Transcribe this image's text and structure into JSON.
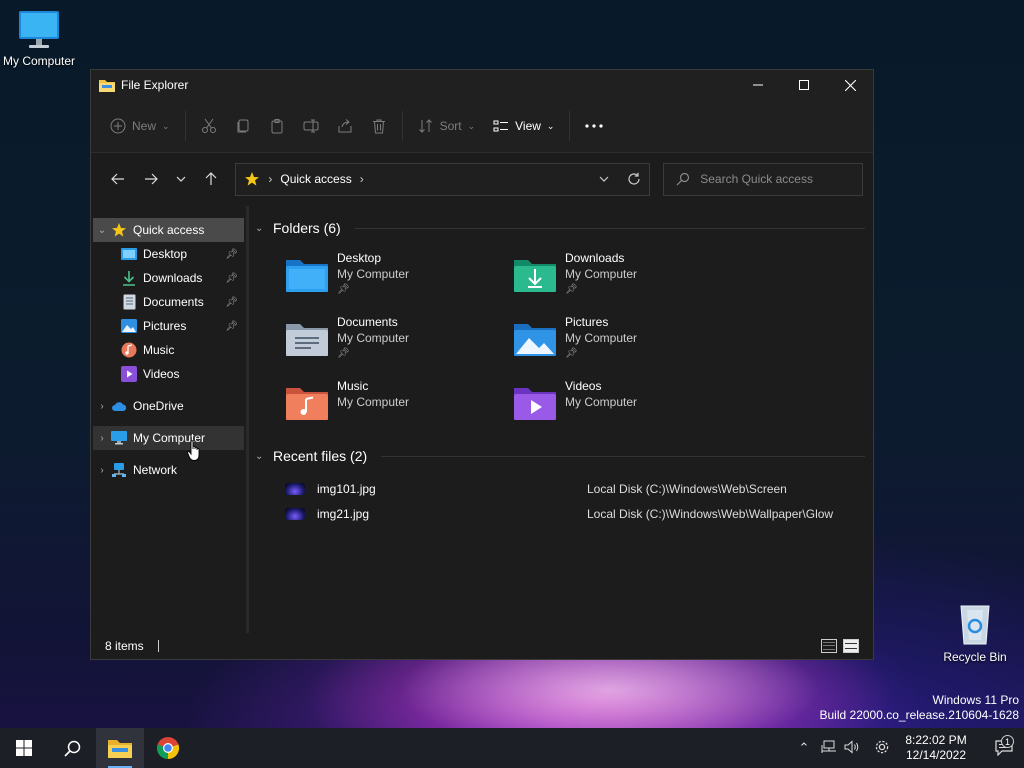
{
  "desktop": {
    "my_computer_label": "My Computer",
    "recycle_bin_label": "Recycle Bin"
  },
  "window": {
    "title": "File Explorer",
    "toolbar": {
      "new_label": "New",
      "sort_label": "Sort",
      "view_label": "View"
    },
    "address": {
      "crumb": "Quick access"
    },
    "search": {
      "placeholder": "Search Quick access"
    },
    "sidebar": {
      "items": [
        {
          "label": "Quick access"
        },
        {
          "label": "Desktop"
        },
        {
          "label": "Downloads"
        },
        {
          "label": "Documents"
        },
        {
          "label": "Pictures"
        },
        {
          "label": "Music"
        },
        {
          "label": "Videos"
        },
        {
          "label": "OneDrive"
        },
        {
          "label": "My Computer"
        },
        {
          "label": "Network"
        }
      ]
    },
    "folders_header": "Folders (6)",
    "folders": [
      {
        "name": "Desktop",
        "location": "My Computer",
        "pinned": true
      },
      {
        "name": "Downloads",
        "location": "My Computer",
        "pinned": true
      },
      {
        "name": "Documents",
        "location": "My Computer",
        "pinned": true
      },
      {
        "name": "Pictures",
        "location": "My Computer",
        "pinned": true
      },
      {
        "name": "Music",
        "location": "My Computer",
        "pinned": false
      },
      {
        "name": "Videos",
        "location": "My Computer",
        "pinned": false
      }
    ],
    "recent_header": "Recent files (2)",
    "recent": [
      {
        "name": "img101.jpg",
        "location": "Local Disk (C:)\\Windows\\Web\\Screen"
      },
      {
        "name": "img21.jpg",
        "location": "Local Disk (C:)\\Windows\\Web\\Wallpaper\\Glow"
      }
    ],
    "status": {
      "items_count": "8 items"
    }
  },
  "watermark": {
    "line1": "Windows 11 Pro",
    "line2": "Build 22000.co_release.210604-1628"
  },
  "taskbar": {
    "time": "8:22:02 PM",
    "date": "12/14/2022",
    "notification_count": "1"
  }
}
